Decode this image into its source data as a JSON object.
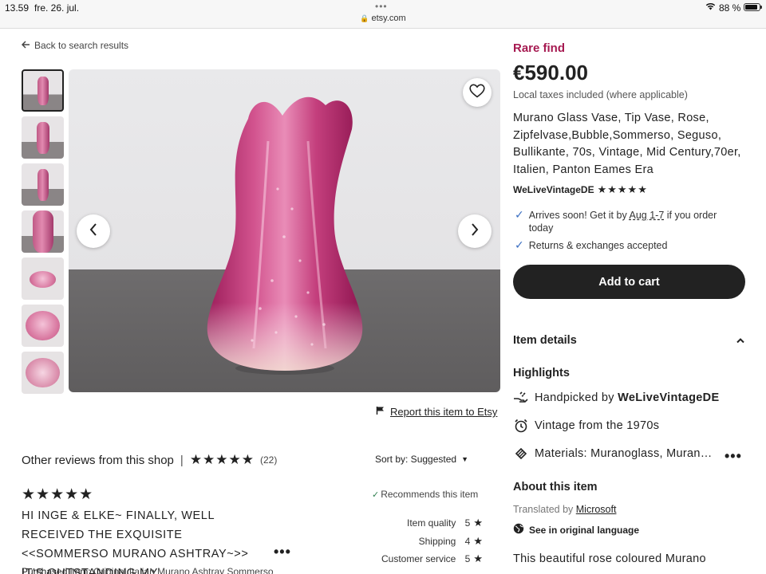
{
  "status_bar": {
    "time": "13.59",
    "date": "fre. 26. jul.",
    "url": "etsy.com",
    "battery": "88 %",
    "battery_level": 0.88
  },
  "nav": {
    "back_label": "Back to search results"
  },
  "gallery": {
    "thumbnail_count": 7,
    "favorite_icon": "heart-icon",
    "prev_icon": "chevron-left-icon",
    "next_icon": "chevron-right-icon"
  },
  "report_label": "Report this item to Etsy",
  "reviews": {
    "heading": "Other reviews from this shop",
    "separator": "|",
    "stars": "★★★★★",
    "count": "(22)",
    "sort_label": "Sort by: Suggested",
    "review": {
      "stars": "★★★★★",
      "text": "HI INGE & ELKE~ FINALLY, WELL RECEIVED THE EXQUISITE <<SOMMERSO MURANO ASHTRAY~>> IT'S OUTSTANDING MY…",
      "recommends": "Recommends this item",
      "purchased_label": "Purchased item:",
      "purchased_item": "Original Italian Murano Ashtray Sommerso",
      "ratings": [
        {
          "label": "Item quality",
          "value": "5"
        },
        {
          "label": "Shipping",
          "value": "4"
        },
        {
          "label": "Customer service",
          "value": "5"
        }
      ]
    }
  },
  "product": {
    "badge": "Rare find",
    "price": "€590.00",
    "tax_note": "Local taxes included (where applicable)",
    "title": "Murano Glass Vase, Tip Vase, Rose, Zipfelvase,Bubble,Sommerso, Seguso, Bullikante, 70s, Vintage, Mid Century,70er, Italien, Panton Eames Era",
    "seller": "WeLiveVintageDE",
    "seller_stars": "★★★★★",
    "perks": {
      "arrives_prefix": "Arrives soon! Get it by ",
      "arrives_date": "Aug 1-7",
      "arrives_suffix": " if you order today",
      "returns": "Returns & exchanges accepted"
    },
    "add_to_cart": "Add to cart",
    "item_details": "Item details",
    "highlights_title": "Highlights",
    "highlights": {
      "handpicked_prefix": "Handpicked by ",
      "handpicked_shop": "WeLiveVintageDE",
      "vintage": "Vintage from the 1970s",
      "materials": "Materials: Muranoglass, Muran…"
    },
    "about_title": "About this item",
    "translated_prefix": "Translated by ",
    "translated_by": "Microsoft",
    "see_original": "See in original language",
    "description_start": "This beautiful rose coloured Murano"
  },
  "colors": {
    "badge": "#a61a51",
    "cart_bg": "#222222",
    "check": "#3b6fc2"
  }
}
